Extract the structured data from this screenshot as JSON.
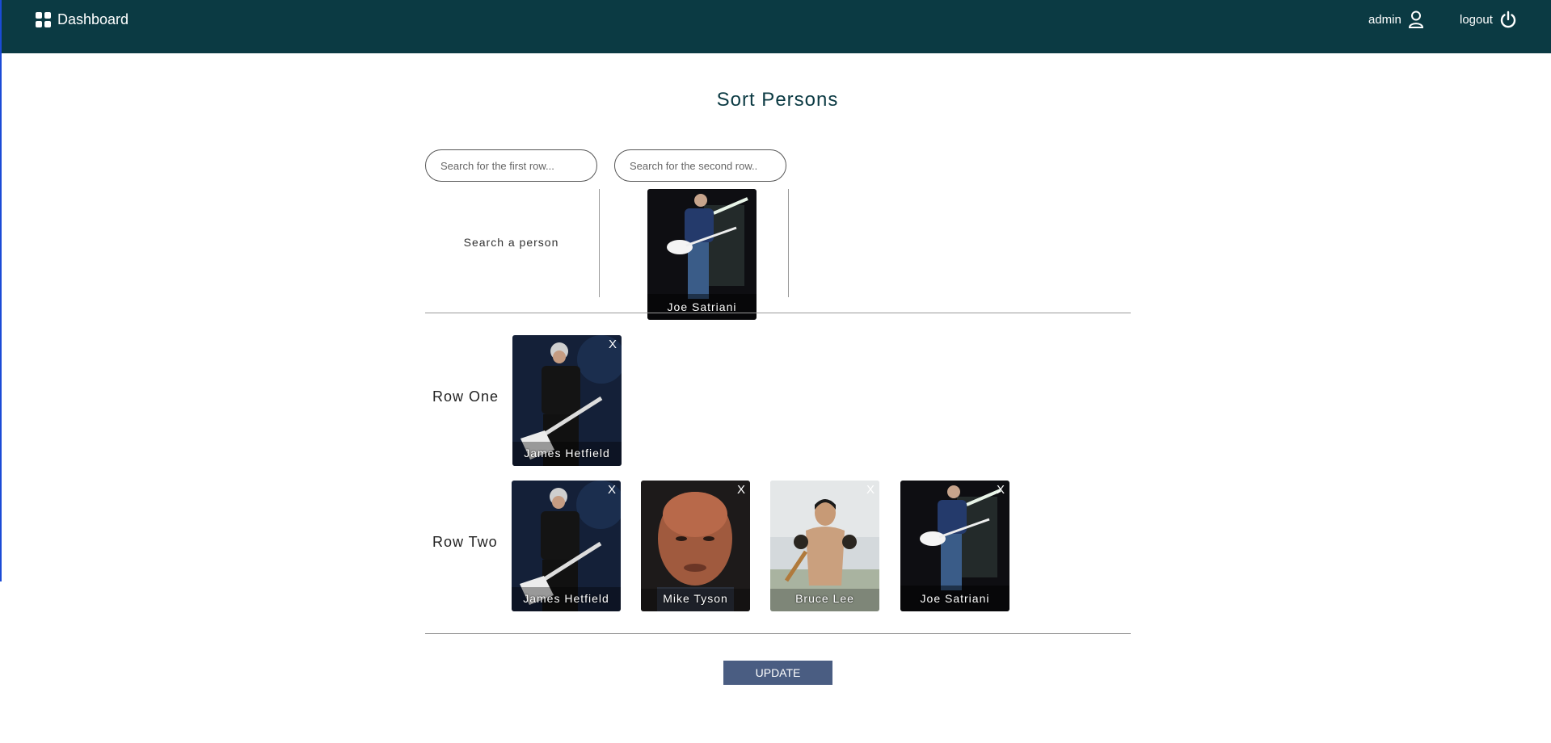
{
  "nav": {
    "brand": "Dashboard",
    "brand_icon": "grid-icon",
    "admin_label": "admin",
    "admin_icon": "user-icon",
    "logout_label": "logout",
    "logout_icon": "power-icon"
  },
  "page": {
    "title": "Sort Persons"
  },
  "search": {
    "first_placeholder": "Search for the first row...",
    "second_placeholder": "Search for the second row..",
    "first_value": "",
    "second_value": "",
    "hint": "Search a person"
  },
  "search_results": [
    {
      "name": "Joe Satriani"
    }
  ],
  "rows": {
    "one": {
      "label": "Row One",
      "persons": [
        {
          "name": "James Hetfield",
          "remove": "X"
        }
      ]
    },
    "two": {
      "label": "Row Two",
      "persons": [
        {
          "name": "James Hetfield",
          "remove": "X"
        },
        {
          "name": "Mike Tyson",
          "remove": "X"
        },
        {
          "name": "Bruce Lee",
          "remove": "X"
        },
        {
          "name": "Joe Satriani",
          "remove": "X"
        }
      ]
    }
  },
  "actions": {
    "update_label": "UPDATE"
  },
  "colors": {
    "navbar": "#0b3a43",
    "button": "#4a5d82",
    "divider": "#999999"
  }
}
